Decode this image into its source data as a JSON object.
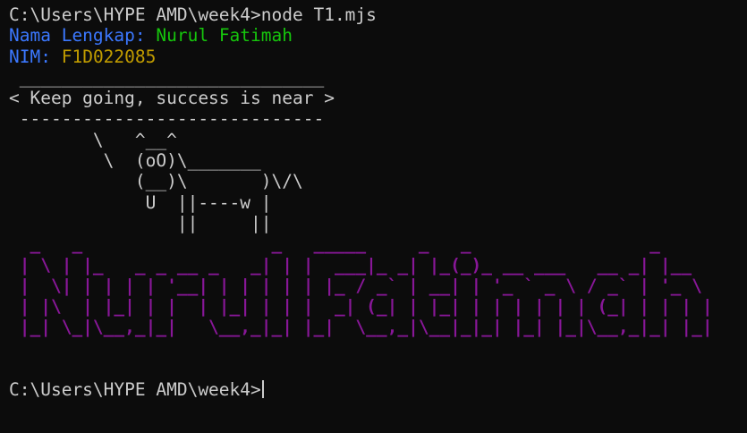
{
  "terminal": {
    "command_line": "C:\\Users\\HYPE AMD\\week4>node T1.mjs",
    "name_label": "Nama Lengkap:",
    "name_value": "Nurul Fatimah",
    "nim_label": "NIM:",
    "nim_value": "F1D022085",
    "cowsay": " _____________________________\n< Keep going, success is near >\n -----------------------------\n        \\   ^__^\n         \\  (oO)\\_______\n            (__)\\       )\\/\\\n             U  ||----w |\n                ||     ||",
    "figlet": "  _   _                  _   _____     _   _                 _     \n | \\ | |_   _ _ __ _   _| | |  ___|_ _| |_(_)_ __ ___   __ _| |__  \n |  \\| | | | | '__| | | | | | |_ / _` | __| | '_ ` _ \\ / _` | '_ \\ \n | |\\  | |_| | |  | |_| | | |  _| (_| | |_| | | | | | | (_| | | | |\n |_| \\_|\\__,_|_|   \\__,_|_| |_|  \\__,_|\\__|_|_| |_| |_|\\__,_|_| |_|",
    "prompt": "C:\\Users\\HYPE AMD\\week4>"
  },
  "colors": {
    "background": "#0c0c0c",
    "foreground": "#cccccc",
    "label_blue": "#3b78ff",
    "name_green": "#16c60c",
    "nim_yellow": "#c19c00",
    "figlet_purple": "#881798"
  }
}
